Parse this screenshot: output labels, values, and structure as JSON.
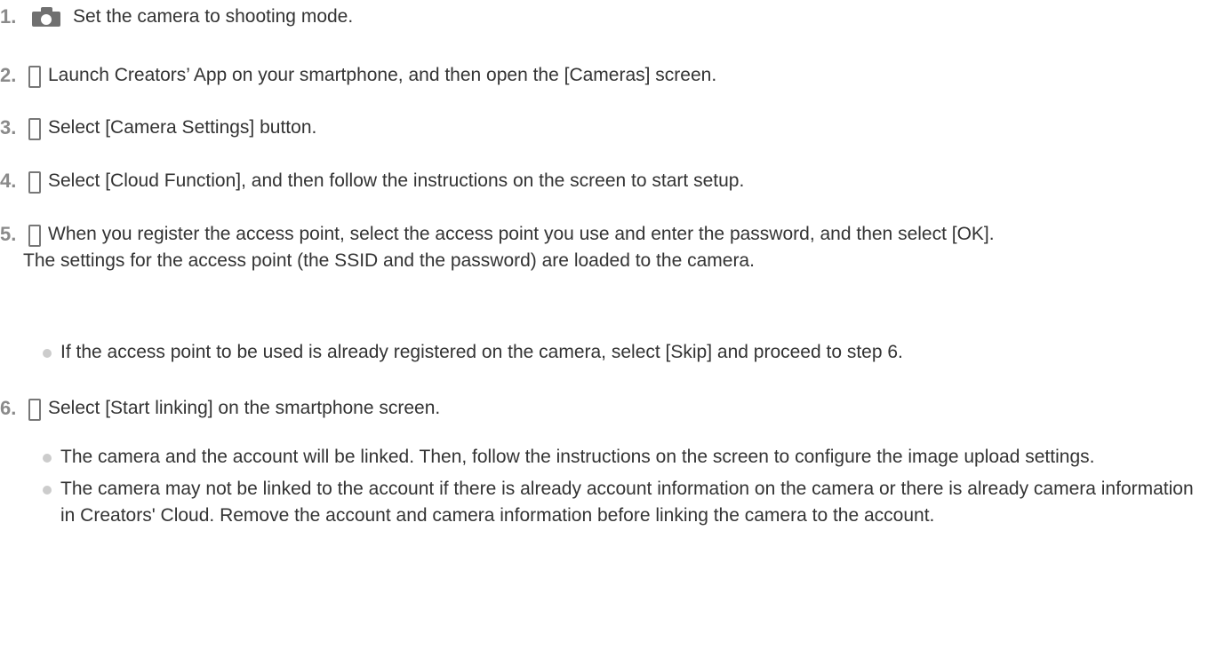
{
  "steps": [
    {
      "num": "1.",
      "icon": "camera-icon",
      "text": "Set the camera to shooting mode."
    },
    {
      "num": "2.",
      "icon": "smartphone-icon",
      "text": "Launch Creators’ App on your smartphone, and then open the [Cameras] screen."
    },
    {
      "num": "3.",
      "icon": "smartphone-icon",
      "text": "Select [Camera Settings] button."
    },
    {
      "num": "4.",
      "icon": "smartphone-icon",
      "text": "Select [Cloud Function], and then follow the instructions on the screen to start setup."
    },
    {
      "num": "5.",
      "icon": "smartphone-icon",
      "text": "When you register the access point, select the access point you use and enter the password, and then select [OK].",
      "detail": "The settings for the access point (the SSID and the password) are loaded to the camera.",
      "bullets": [
        "If the access point to be used is already registered on the camera, select [Skip] and proceed to step 6."
      ]
    },
    {
      "num": "6.",
      "icon": "smartphone-icon",
      "text": "Select [Start linking] on the smartphone screen.",
      "bullets": [
        "The camera and the account will be linked. Then, follow the instructions on the screen to configure the image upload settings.",
        "The camera may not be linked to the account if there is already account information on the camera or there is already camera information in Creators' Cloud. Remove the account and camera information before linking the camera to the account."
      ]
    }
  ]
}
